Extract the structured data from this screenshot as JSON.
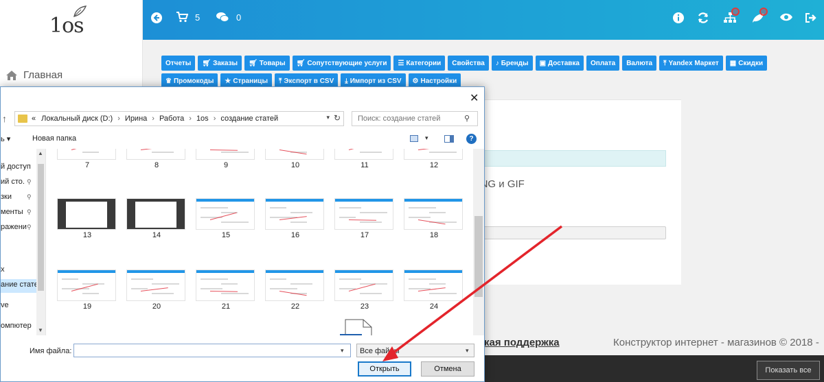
{
  "sidebar": {
    "logo_text": "1os",
    "home_label": "Главная"
  },
  "topbar": {
    "cart_count": "5",
    "messages_count": "0"
  },
  "nav_buttons": [
    {
      "label": "Отчеты",
      "icon": ""
    },
    {
      "label": "Заказы",
      "icon": "cart-icon"
    },
    {
      "label": "Товары",
      "icon": "cart-icon"
    },
    {
      "label": "Сопутствующие услуги",
      "icon": "cart-icon"
    },
    {
      "label": "Категории",
      "icon": "list-icon"
    },
    {
      "label": "Свойства",
      "icon": ""
    },
    {
      "label": "Бренды",
      "icon": "bell-icon"
    },
    {
      "label": "Доставка",
      "icon": "truck-icon"
    },
    {
      "label": "Оплата",
      "icon": ""
    },
    {
      "label": "Валюта",
      "icon": ""
    },
    {
      "label": "Yandex Маркет",
      "icon": "upload-icon"
    },
    {
      "label": "Скидки",
      "icon": "gift-icon"
    },
    {
      "label": "Промокоды",
      "icon": "trophy-icon"
    },
    {
      "label": "Страницы",
      "icon": "star-icon"
    },
    {
      "label": "Экспорт в CSV",
      "icon": "upload-icon"
    },
    {
      "label": "Импорт из CSV",
      "icon": "download-icon"
    },
    {
      "label": "Настройки",
      "icon": "gear-icon"
    }
  ],
  "main": {
    "formats_text": "ые форматы файлов: JPG, PNG и GIF",
    "support_link": "кая поддержка",
    "copyright": "Конструктор интернет - магазинов © 2018 -",
    "hide_all_button": "Показать все"
  },
  "dialog": {
    "breadcrumb": [
      "«",
      "Локальный диск (D:)",
      "Ирина",
      "Работа",
      "1os",
      "создание статей"
    ],
    "search_placeholder": "Поиск: создание статей",
    "organize_label": "ь",
    "new_folder_label": "Новая папка",
    "nav_items": [
      {
        "label": "й доступ",
        "pinned": false
      },
      {
        "label": "ий сто.",
        "pinned": true
      },
      {
        "label": "зки",
        "pinned": true
      },
      {
        "label": "менты",
        "pinned": true
      },
      {
        "label": "ражени",
        "pinned": true
      },
      {
        "label": "х",
        "pinned": false
      },
      {
        "label": "ание статей",
        "pinned": false
      },
      {
        "label": "ve",
        "pinned": false
      },
      {
        "label": "омпютер",
        "pinned": false
      }
    ],
    "files": [
      "7",
      "8",
      "9",
      "10",
      "11",
      "12",
      "13",
      "14",
      "15",
      "16",
      "17",
      "18",
      "19",
      "20",
      "21",
      "22",
      "23",
      "24"
    ],
    "file_name_label": "Имя файла:",
    "file_name_value": "",
    "file_type_value": "Все файлы",
    "open_button": "Открыть",
    "cancel_button": "Отмена"
  },
  "colors": {
    "topbar_start": "#1d8fd6",
    "topbar_end": "#1fb0d6",
    "nav_button": "#1e90e8",
    "annotation_arrow": "#e3242b"
  }
}
